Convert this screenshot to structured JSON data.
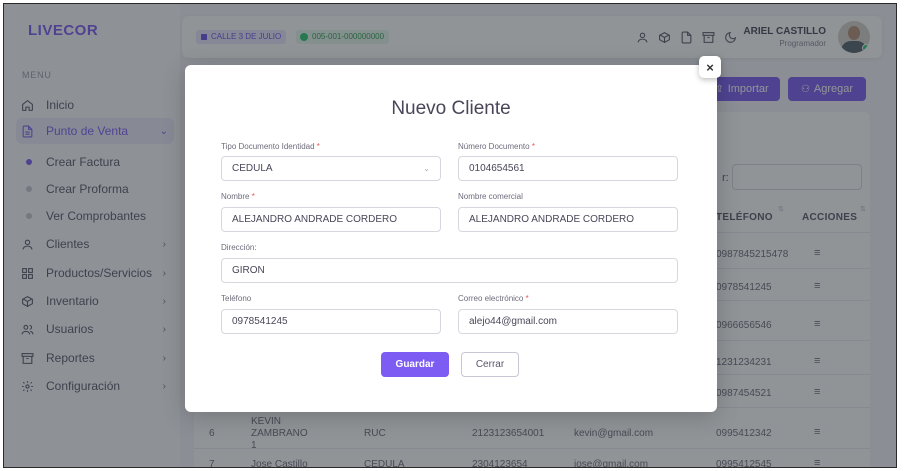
{
  "app": {
    "brand": "LIVECOR"
  },
  "sidebar": {
    "menu_title": "MENU",
    "items": [
      {
        "label": "Inicio",
        "icon": "home-icon"
      },
      {
        "label": "Punto de Venta",
        "icon": "document-icon",
        "expanded": true
      },
      {
        "label": "Clientes",
        "icon": "user-icon"
      },
      {
        "label": "Productos/Servicios",
        "icon": "grid-icon"
      },
      {
        "label": "Inventario",
        "icon": "box-icon"
      },
      {
        "label": "Usuarios",
        "icon": "users-icon"
      },
      {
        "label": "Reportes",
        "icon": "archive-icon"
      },
      {
        "label": "Configuración",
        "icon": "settings-icon"
      }
    ],
    "sub_items": [
      {
        "label": "Crear Factura",
        "active": true
      },
      {
        "label": "Crear Proforma"
      },
      {
        "label": "Ver Comprobantes"
      }
    ]
  },
  "topbar": {
    "store": "CALLE 3 DE JULIO",
    "point": "005-001-000000000",
    "user_name": "ARIEL CASTILLO",
    "user_role": "Programador"
  },
  "page": {
    "import_label": "Importar",
    "add_label": "Agregar",
    "search_label": "r:",
    "columns": {
      "phone": "TELÉFONO",
      "actions": "ACCIONES"
    },
    "phones": [
      "0987845215478",
      "0978541245",
      "0966656546",
      "1231234231",
      "0987454521"
    ],
    "rows": [
      {
        "num": "6",
        "name": "KEVIN ZAMBRANO 1",
        "type": "RUC",
        "doc": "2123123654001",
        "email": "kevin@gmail.com",
        "phone": "0995412342"
      },
      {
        "num": "7",
        "name": "Jose Castillo",
        "type": "CEDULA",
        "doc": "2304123654",
        "email": "jose@gmail.com",
        "phone": "0995412545"
      }
    ]
  },
  "modal": {
    "title": "Nuevo Cliente",
    "fields": {
      "tipo_documento": {
        "label": "Tipo Documento Identidad",
        "value": "CEDULA"
      },
      "numero_documento": {
        "label": "Número Documento",
        "value": "0104654561"
      },
      "nombre": {
        "label": "Nombre",
        "value": "ALEJANDRO ANDRADE CORDERO"
      },
      "nombre_comercial": {
        "label": "Nombre comercial",
        "value": "ALEJANDRO ANDRADE CORDERO"
      },
      "direccion": {
        "label": "Dirección:",
        "value": "GIRON"
      },
      "telefono": {
        "label": "Teléfono",
        "value": "0978541245"
      },
      "correo": {
        "label": "Correo electrónico",
        "value": "alejo44@gmail.com"
      }
    },
    "required_mark": "*",
    "save_label": "Guardar",
    "close_label": "Cerrar",
    "close_x": "×"
  },
  "colors": {
    "accent": "#7c5cf2",
    "success": "#28c76f",
    "danger": "#ea5455"
  }
}
